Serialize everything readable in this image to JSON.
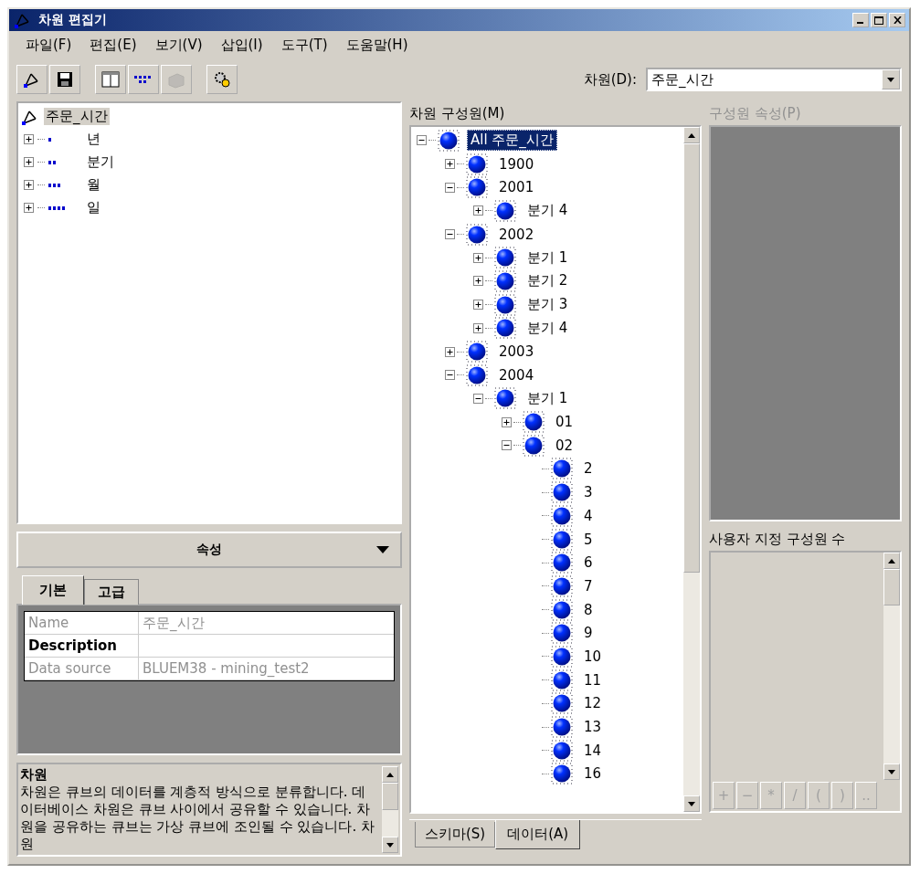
{
  "window": {
    "title": "차원 편집기"
  },
  "menu": [
    "파일(F)",
    "편집(E)",
    "보기(V)",
    "삽입(I)",
    "도구(T)",
    "도움말(H)"
  ],
  "toolbar": {
    "buttons": [
      {
        "kind": "dimension",
        "disabled": false
      },
      {
        "kind": "save",
        "disabled": false
      },
      {
        "kind": "table",
        "disabled": false
      },
      {
        "kind": "levels",
        "disabled": false
      },
      {
        "kind": "cube",
        "disabled": true
      },
      {
        "kind": "wizard",
        "disabled": false
      }
    ],
    "dimension_label": "차원(D):",
    "dimension_value": "주문_시간"
  },
  "dimension_tree": {
    "root": {
      "label": "주문_시간",
      "selected": true
    },
    "levels": [
      {
        "label": "년",
        "expanded": false
      },
      {
        "label": "분기",
        "expanded": false
      },
      {
        "label": "월",
        "expanded": false
      },
      {
        "label": "일",
        "expanded": false
      }
    ]
  },
  "properties": {
    "header": "속성",
    "tabs": [
      {
        "label": "기본",
        "selected": true
      },
      {
        "label": "고급",
        "selected": false
      }
    ],
    "rows": [
      {
        "name": "Name",
        "value": "주문_시간",
        "enabled": false
      },
      {
        "name": "Description",
        "enabled": true
      },
      {
        "name": "Data source",
        "value": "BLUEM38 - mining_test2",
        "enabled": false
      }
    ]
  },
  "description": {
    "title": "차원",
    "text": "차원은 큐브의 데이터를 계층적 방식으로 분류합니다. 데이터베이스 차원은 큐브 사이에서 공유할 수 있습니다. 차원을 공유하는 큐브는 가상 큐브에 조인될 수 있습니다. 차원"
  },
  "members": {
    "label": "차원 구성원(M)",
    "tree": [
      {
        "label": "All 주문_시간",
        "selected": true,
        "expanded": true,
        "children": [
          {
            "label": "1900",
            "selected": false,
            "expanded": false
          },
          {
            "label": "2001",
            "selected": false,
            "expanded": true,
            "children": [
              {
                "label": "분기 4",
                "selected": false,
                "expanded": false
              }
            ]
          },
          {
            "label": "2002",
            "selected": false,
            "expanded": true,
            "children": [
              {
                "label": "분기 1",
                "selected": false,
                "expanded": false
              },
              {
                "label": "분기 2",
                "selected": false,
                "expanded": false
              },
              {
                "label": "분기 3",
                "selected": false,
                "expanded": false
              },
              {
                "label": "분기 4",
                "selected": false,
                "expanded": false
              }
            ]
          },
          {
            "label": "2003",
            "selected": false,
            "expanded": false
          },
          {
            "label": "2004",
            "selected": false,
            "expanded": true,
            "children": [
              {
                "label": "분기 1",
                "selected": false,
                "expanded": true,
                "children": [
                  {
                    "label": "01",
                    "selected": false,
                    "expanded": false
                  },
                  {
                    "label": "02",
                    "selected": false,
                    "expanded": true,
                    "children": [
                      {
                        "label": "2",
                        "selected": false
                      },
                      {
                        "label": "3",
                        "selected": false
                      },
                      {
                        "label": "4",
                        "selected": false
                      },
                      {
                        "label": "5",
                        "selected": false
                      },
                      {
                        "label": "6",
                        "selected": false
                      },
                      {
                        "label": "7",
                        "selected": false
                      },
                      {
                        "label": "8",
                        "selected": false
                      },
                      {
                        "label": "9",
                        "selected": false
                      },
                      {
                        "label": "10",
                        "selected": false
                      },
                      {
                        "label": "11",
                        "selected": false
                      },
                      {
                        "label": "12",
                        "selected": false
                      },
                      {
                        "label": "13",
                        "selected": false
                      },
                      {
                        "label": "14",
                        "selected": false
                      },
                      {
                        "label": "16",
                        "selected": false
                      }
                    ]
                  }
                ]
              }
            ]
          }
        ]
      }
    ],
    "tabs": [
      {
        "label": "스키마(S)",
        "selected": false
      },
      {
        "label": "데이터(A)",
        "selected": true
      }
    ]
  },
  "member_properties": {
    "label": "구성원 속성(P)",
    "disabled": true
  },
  "custom_formula": {
    "label": "사용자 지정 구성원 수",
    "buttons": [
      {
        "label": "+",
        "disabled": true
      },
      {
        "label": "−",
        "disabled": true
      },
      {
        "label": "*",
        "disabled": true
      },
      {
        "label": "/",
        "disabled": true
      },
      {
        "label": "(",
        "disabled": true
      },
      {
        "label": ")",
        "disabled": true
      },
      {
        "label": "..",
        "disabled": true
      }
    ]
  }
}
